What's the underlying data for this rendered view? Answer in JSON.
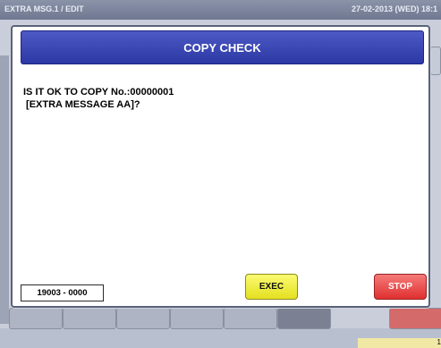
{
  "topbar": {
    "title": "EXTRA MSG.1 / EDIT",
    "datetime": "27-02-2013 (WED) 18:1"
  },
  "background": {
    "page_indicator": "1"
  },
  "dialog": {
    "title": "COPY CHECK",
    "message_line1": "IS IT OK TO COPY No.:00000001",
    "message_line2": " [EXTRA MESSAGE AA]?",
    "code": "19003 - 0000",
    "exec_label": "EXEC",
    "stop_label": "STOP"
  },
  "colors": {
    "header_blue": "#2c38a4",
    "exec_yellow": "#f0ee40",
    "stop_red": "#e03030"
  }
}
